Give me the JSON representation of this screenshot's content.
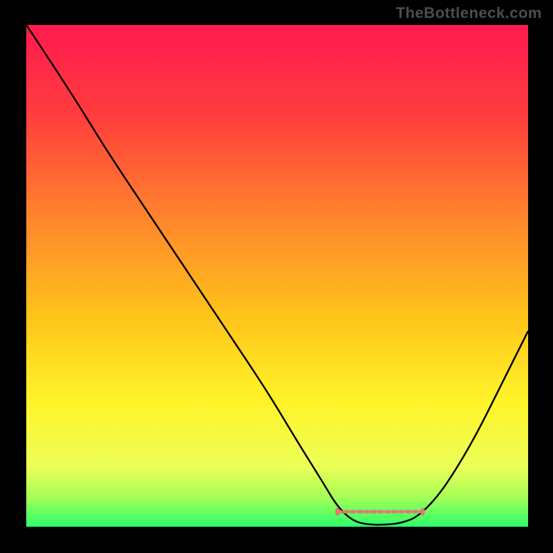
{
  "watermark": "TheBottleneck.com",
  "chart_data": {
    "type": "line",
    "title": "",
    "xlabel": "",
    "ylabel": "",
    "xlim": [
      0,
      100
    ],
    "ylim": [
      0,
      100
    ],
    "gradient_stops": [
      {
        "offset": 0.0,
        "color": "#ff1a50"
      },
      {
        "offset": 0.18,
        "color": "#ff3d3d"
      },
      {
        "offset": 0.4,
        "color": "#ff8a2b"
      },
      {
        "offset": 0.58,
        "color": "#ffc31a"
      },
      {
        "offset": 0.75,
        "color": "#fff429"
      },
      {
        "offset": 0.88,
        "color": "#ecff57"
      },
      {
        "offset": 0.94,
        "color": "#a7ff57"
      },
      {
        "offset": 1.0,
        "color": "#2cff6b"
      }
    ],
    "series": [
      {
        "name": "bottleneck-curve",
        "color": "#000000",
        "width": 2.5,
        "points": [
          {
            "x": 0,
            "y": 100
          },
          {
            "x": 8,
            "y": 88
          },
          {
            "x": 16,
            "y": 75
          },
          {
            "x": 24,
            "y": 63
          },
          {
            "x": 32,
            "y": 51
          },
          {
            "x": 40,
            "y": 39
          },
          {
            "x": 48,
            "y": 27
          },
          {
            "x": 54,
            "y": 17
          },
          {
            "x": 59,
            "y": 9
          },
          {
            "x": 62,
            "y": 4
          },
          {
            "x": 65,
            "y": 1.2
          },
          {
            "x": 68,
            "y": 0.4
          },
          {
            "x": 72,
            "y": 0.4
          },
          {
            "x": 75,
            "y": 0.8
          },
          {
            "x": 78,
            "y": 2.0
          },
          {
            "x": 82,
            "y": 6
          },
          {
            "x": 86,
            "y": 12
          },
          {
            "x": 90,
            "y": 19
          },
          {
            "x": 94,
            "y": 27
          },
          {
            "x": 98,
            "y": 35
          },
          {
            "x": 100,
            "y": 39
          }
        ]
      }
    ],
    "marker_band": {
      "color": "#e17a72",
      "y": 3.0,
      "x_start": 62,
      "x_end": 79,
      "dash": [
        5,
        5
      ],
      "width": 5,
      "end_dot_radius": 4.5
    }
  }
}
